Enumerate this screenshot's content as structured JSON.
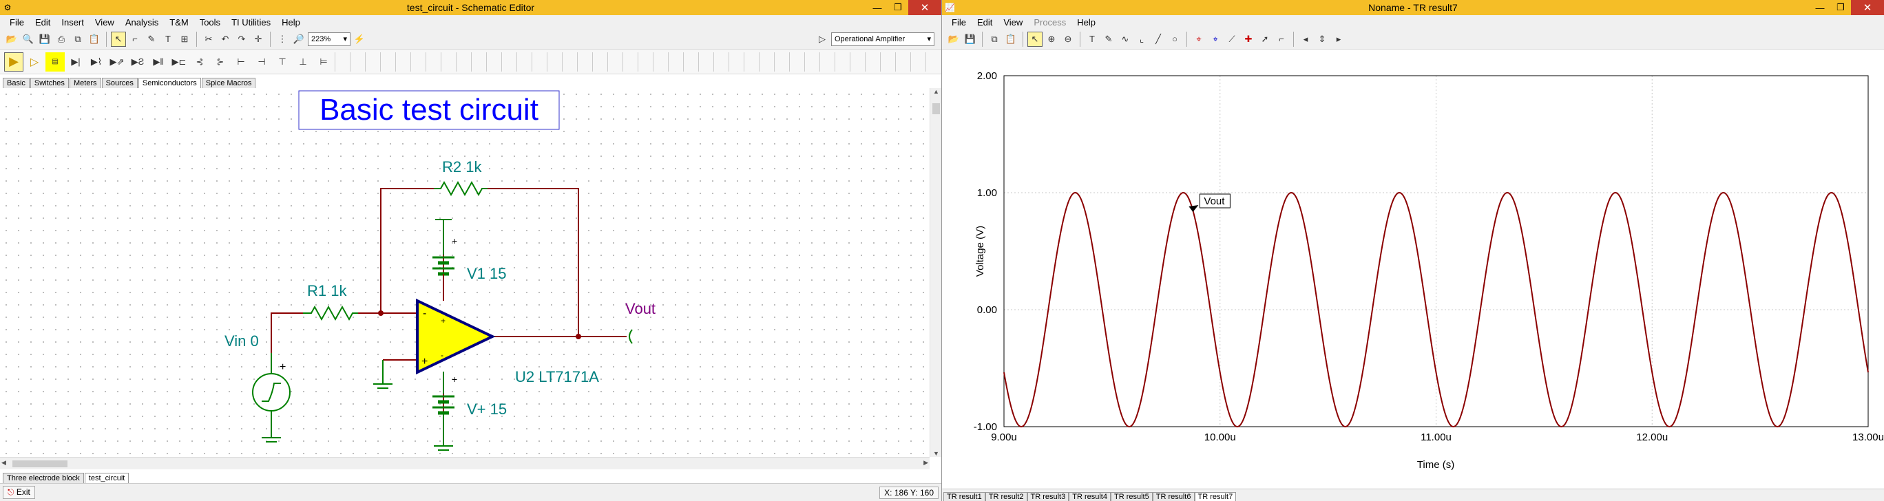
{
  "schematic": {
    "title": "test_circuit - Schematic Editor",
    "menu": [
      "File",
      "Edit",
      "Insert",
      "View",
      "Analysis",
      "T&M",
      "Tools",
      "TI Utilities",
      "Help"
    ],
    "zoom": "223%",
    "component_select": "Operational Amplifier",
    "palette_tabs": [
      "Basic",
      "Switches",
      "Meters",
      "Sources",
      "Semiconductors",
      "Spice Macros"
    ],
    "active_palette_tab": "Semiconductors",
    "doc_tabs": [
      "Three electrode block",
      "test_circuit"
    ],
    "active_doc_tab": "test_circuit",
    "status_exit": "Exit",
    "status_coords": "X: 186 Y: 160",
    "circuit": {
      "title": "Basic test circuit",
      "r2": "R2 1k",
      "r1": "R1 1k",
      "v1": "V1 15",
      "vplus": "V+ 15",
      "vin": "Vin 0",
      "u2": "U2 LT7171A",
      "vout": "Vout",
      "plus": "+",
      "minus": "-"
    },
    "colors": {
      "title_bar": "#f5be27",
      "opamp_fill": "#ffff00",
      "opamp_outline": "#000080",
      "wire": "#8b0000",
      "component": "#008000",
      "label": "#008080",
      "vout": "#800080",
      "title_text": "#0000ff"
    }
  },
  "result": {
    "title": "Noname - TR result7",
    "menu": [
      "File",
      "Edit",
      "View",
      "Process",
      "Help"
    ],
    "disabled_menu": [
      "Process"
    ],
    "result_tabs": [
      "TR result1",
      "TR result2",
      "TR result3",
      "TR result4",
      "TR result5",
      "TR result6",
      "TR result7"
    ],
    "active_result_tab": "TR result7"
  },
  "chart_data": {
    "type": "line",
    "xlabel": "Time (s)",
    "ylabel": "Voltage (V)",
    "xlim": [
      9.0,
      13.0
    ],
    "ylim": [
      -1.0,
      2.0
    ],
    "x_ticks": [
      "9.00u",
      "10.00u",
      "11.00u",
      "12.00u",
      "13.00u"
    ],
    "y_ticks": [
      "2.00",
      "1.00",
      "0.00",
      "-1.00"
    ],
    "grid": true,
    "series": [
      {
        "name": "Vout",
        "color": "#8b0000",
        "peaks_at": [
          9.33,
          9.83,
          10.33,
          10.83,
          11.33,
          11.83,
          12.33,
          12.83
        ],
        "troughs_at": [
          9.08,
          9.58,
          10.08,
          10.58,
          11.08,
          11.58,
          12.08,
          12.58
        ],
        "amplitude": 1.0,
        "period": 0.5
      }
    ],
    "annotation": {
      "label": "Vout",
      "x": 9.83,
      "y": 1.0
    }
  }
}
